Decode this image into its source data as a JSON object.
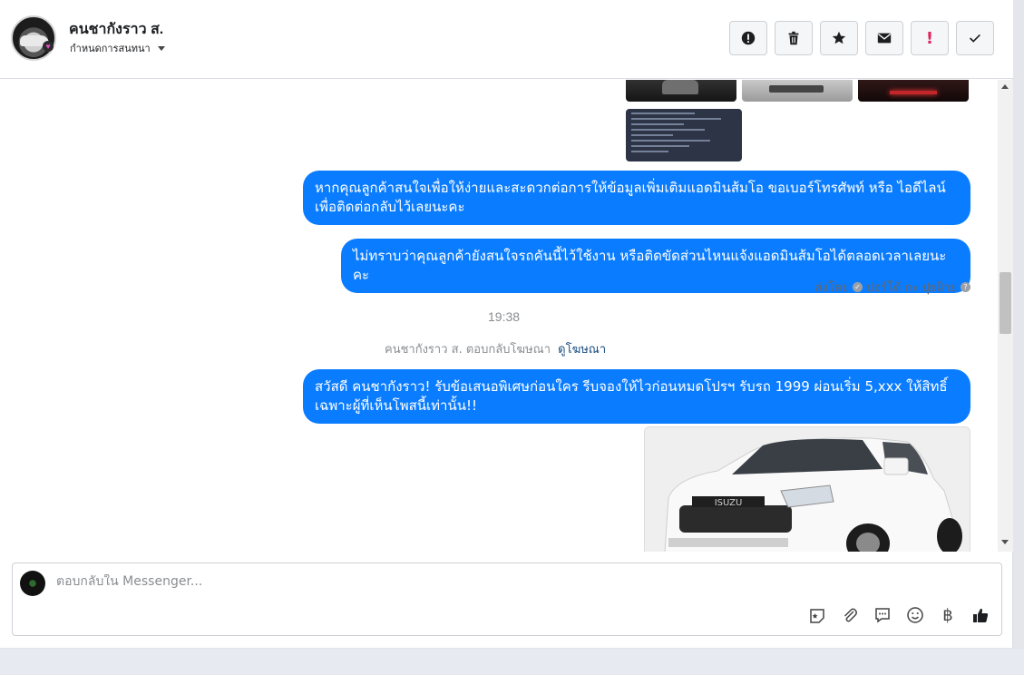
{
  "header": {
    "contact_name": "คนชากังราว ส.",
    "assign_label": "กำหนดการสนทนา"
  },
  "messages": {
    "bubble_1": "หากคุณลูกค้าสนใจเพื่อให้ง่ายและสะดวกต่อการให้ข้อมูลเพิ่มเติมแอดมินส้มโอ ขอเบอร์โทรศัพท์ หรือ ไอดีไลน์ เพื่อติดต่อกลับไว้เลยนะคะ",
    "bubble_2": "ไม่ทราบว่าคุณลูกค้ายังสนใจรถคันนี้ไว้ใช้งาน หรือติดขัดส่วนไหนแจ้งแอดมินส้มโอได้ตลอดเวลาเลยนะคะ",
    "sent_by_label": "ส่งโดย",
    "sent_by_name": "ปอร์โต้ กะ ปุยฝ้าย",
    "time": "19:38",
    "ad_reply_text": "คนชากังราว ส. ตอบกลับโฆษณา",
    "ad_link": "ดูโฆษณา",
    "bubble_3": "สวัสดี คนชากังราว! รับข้อเสนอพิเศษก่อนใคร รีบจองให้ไวก่อนหมดโปรฯ รับรถ 1999 ผ่อนเริ่ม 5,xxx ให้สิทธิ์ เฉพาะผู้ที่เห็นโพสนี้เท่านั้น!!",
    "truck_brand": "ISUZU"
  },
  "composer": {
    "placeholder": "ตอบกลับใน Messenger...",
    "currency_symbol": "฿"
  },
  "colors": {
    "accent": "#0a7cff",
    "danger": "#e0245e"
  },
  "icons": {
    "actions": [
      "alert-circle-icon",
      "trash-icon",
      "star-icon",
      "envelope-icon",
      "exclamation-icon",
      "check-icon"
    ],
    "composer": [
      "sticker-icon",
      "attachment-icon",
      "saved-reply-icon",
      "emoji-icon",
      "baht-icon",
      "thumbs-up-icon"
    ]
  }
}
